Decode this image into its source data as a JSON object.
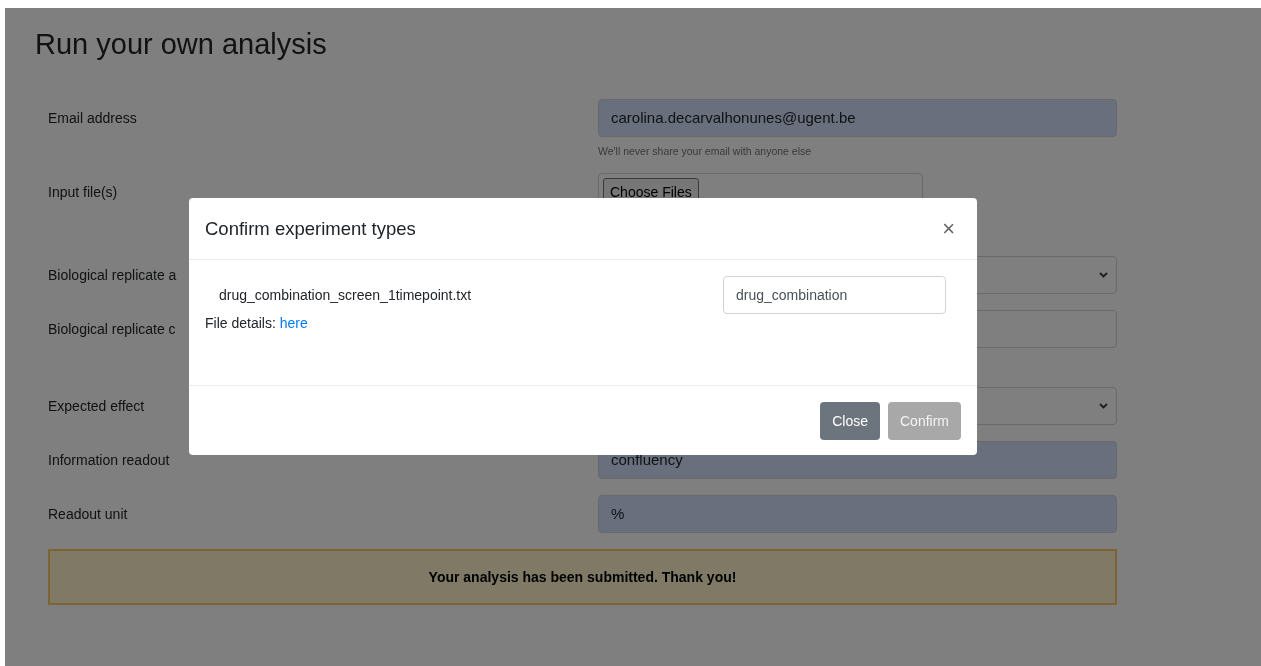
{
  "page": {
    "title": "Run your own analysis",
    "fields": [
      {
        "kind": "input",
        "label": "Email address",
        "value": "carolina.decarvalhonunes@ugent.be",
        "autofilled": true,
        "help": "We'll never share your email with anyone else"
      },
      {
        "kind": "file",
        "label": "Input file(s)",
        "button": "Choose Files"
      },
      {
        "kind": "select",
        "label": "Biological replicate a"
      },
      {
        "kind": "input",
        "label": "Biological replicate c",
        "autofilled": false
      },
      {
        "kind": "select",
        "label": "Expected effect"
      },
      {
        "kind": "input",
        "label": "Information readout",
        "value": "confluency",
        "autofilled": true
      },
      {
        "kind": "input",
        "label": "Readout unit",
        "value": "%",
        "autofilled": true
      }
    ],
    "alert": "Your analysis has been submitted. Thank you!"
  },
  "modal": {
    "title": "Confirm experiment types",
    "close_symbol": "×",
    "files": [
      {
        "name": "drug_combination_screen_1timepoint.txt",
        "type": "drug_combination",
        "details_label": "File details:",
        "details_link": "here"
      }
    ],
    "buttons": [
      {
        "label": "Close",
        "disabled": false
      },
      {
        "label": "Confirm",
        "disabled": true
      }
    ]
  }
}
